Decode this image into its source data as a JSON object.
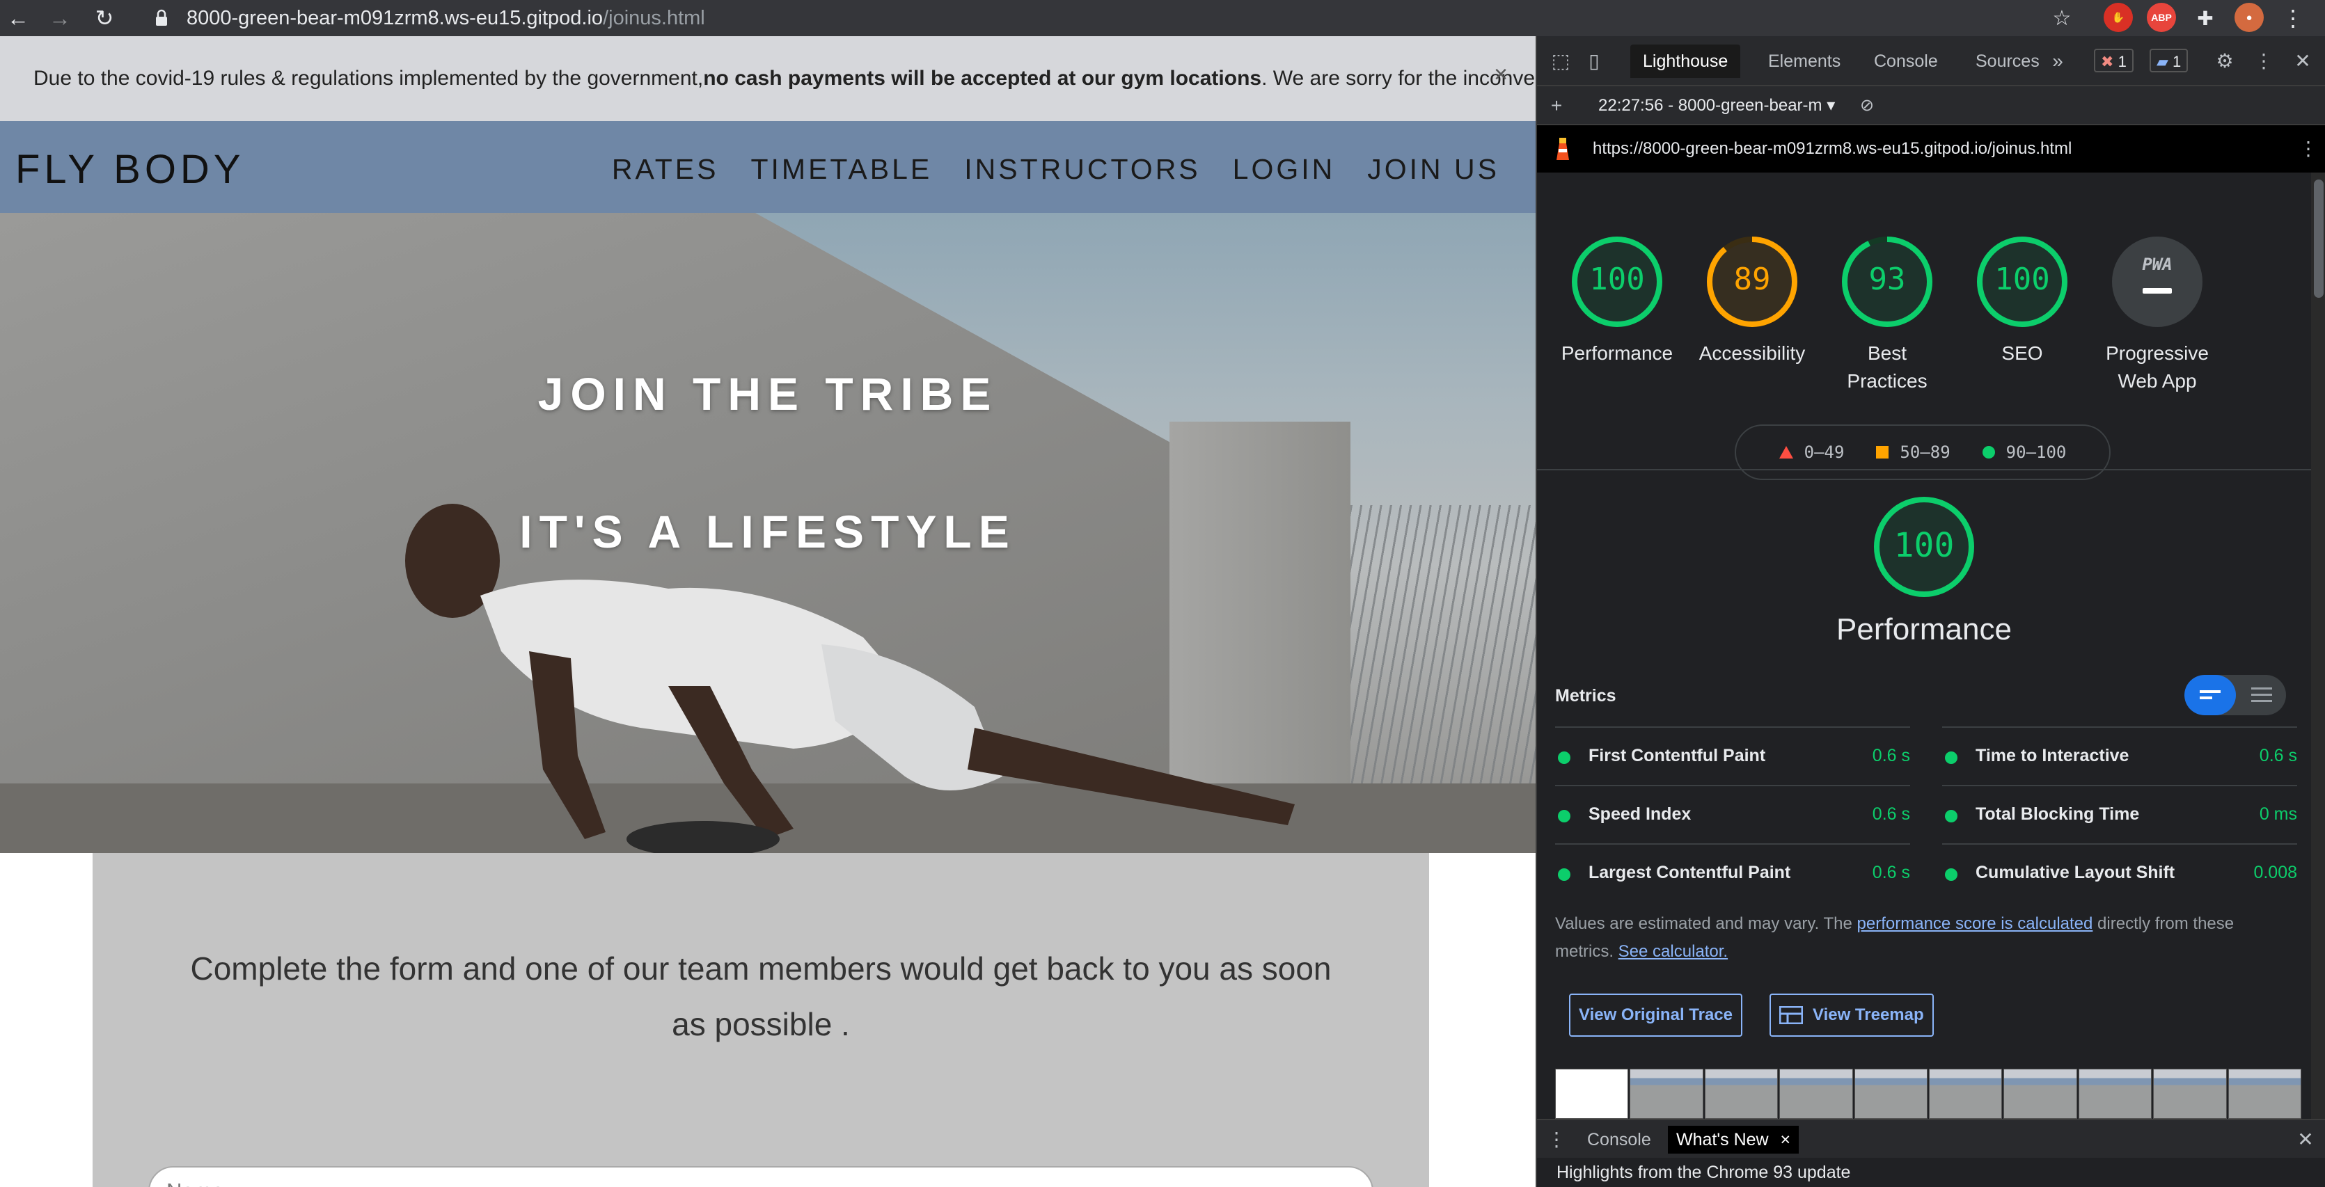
{
  "browser": {
    "url_host": "8000-green-bear-m091zrm8.ws-eu15.gitpod.io",
    "url_path": "/joinus.html",
    "extension_abp": "ABP"
  },
  "site": {
    "banner": {
      "text_before": "Due to the covid-19 rules & regulations implemented by the government, ",
      "text_bold": "no cash payments will be accepted at our gym locations",
      "text_after": ". We are sorry for the inconvenience.",
      "close": "×"
    },
    "brand": "FLY BODY",
    "nav": [
      "RATES",
      "TIMETABLE",
      "INSTRUCTORS",
      "LOGIN",
      "JOIN US"
    ],
    "hero": {
      "title": "JOIN THE TRIBE",
      "subtitle": "IT'S A LIFESTYLE"
    },
    "form": {
      "intro": "Complete the form and one of our team members would get back to you as soon as possible .",
      "name_placeholder": "Name"
    }
  },
  "devtools": {
    "tabs": [
      "Lighthouse",
      "Elements",
      "Console",
      "Sources"
    ],
    "more_tabs": "»",
    "error_count": "1",
    "message_count": "1",
    "report_select": "22:27:56 - 8000-green-bear-m",
    "report_url": "https://8000-green-bear-m091zrm8.ws-eu15.gitpod.io/joinus.html",
    "scores": [
      {
        "label": "Performance",
        "value": "100",
        "score": 100,
        "color": "#0cce6b"
      },
      {
        "label": "Accessibility",
        "value": "89",
        "score": 89,
        "color": "#ffa400"
      },
      {
        "label": "Best Practices",
        "value": "93",
        "score": 93,
        "color": "#0cce6b"
      },
      {
        "label": "SEO",
        "value": "100",
        "score": 100,
        "color": "#0cce6b"
      },
      {
        "label": "Progressive Web App",
        "value": "PWA",
        "score": 0,
        "color": "#9aa0a6"
      }
    ],
    "legend": {
      "fail": "0–49",
      "average": "50–89",
      "pass": "90–100"
    },
    "performance": {
      "score": "100",
      "title": "Performance"
    },
    "metrics_title": "Metrics",
    "metrics": [
      {
        "name": "First Contentful Paint",
        "value": "0.6 s"
      },
      {
        "name": "Time to Interactive",
        "value": "0.6 s"
      },
      {
        "name": "Speed Index",
        "value": "0.6 s"
      },
      {
        "name": "Total Blocking Time",
        "value": "0 ms"
      },
      {
        "name": "Largest Contentful Paint",
        "value": "0.6 s"
      },
      {
        "name": "Cumulative Layout Shift",
        "value": "0.008"
      }
    ],
    "note": {
      "text1": "Values are estimated and may vary. The ",
      "link1": "performance score is calculated",
      "text2": " directly from these metrics. ",
      "link2": "See calculator."
    },
    "buttons": {
      "trace": "View Original Trace",
      "treemap": "View Treemap"
    },
    "drawer": {
      "tabs": [
        "Console",
        "What's New"
      ],
      "close": "×",
      "body": "Highlights from the Chrome 93 update"
    }
  }
}
